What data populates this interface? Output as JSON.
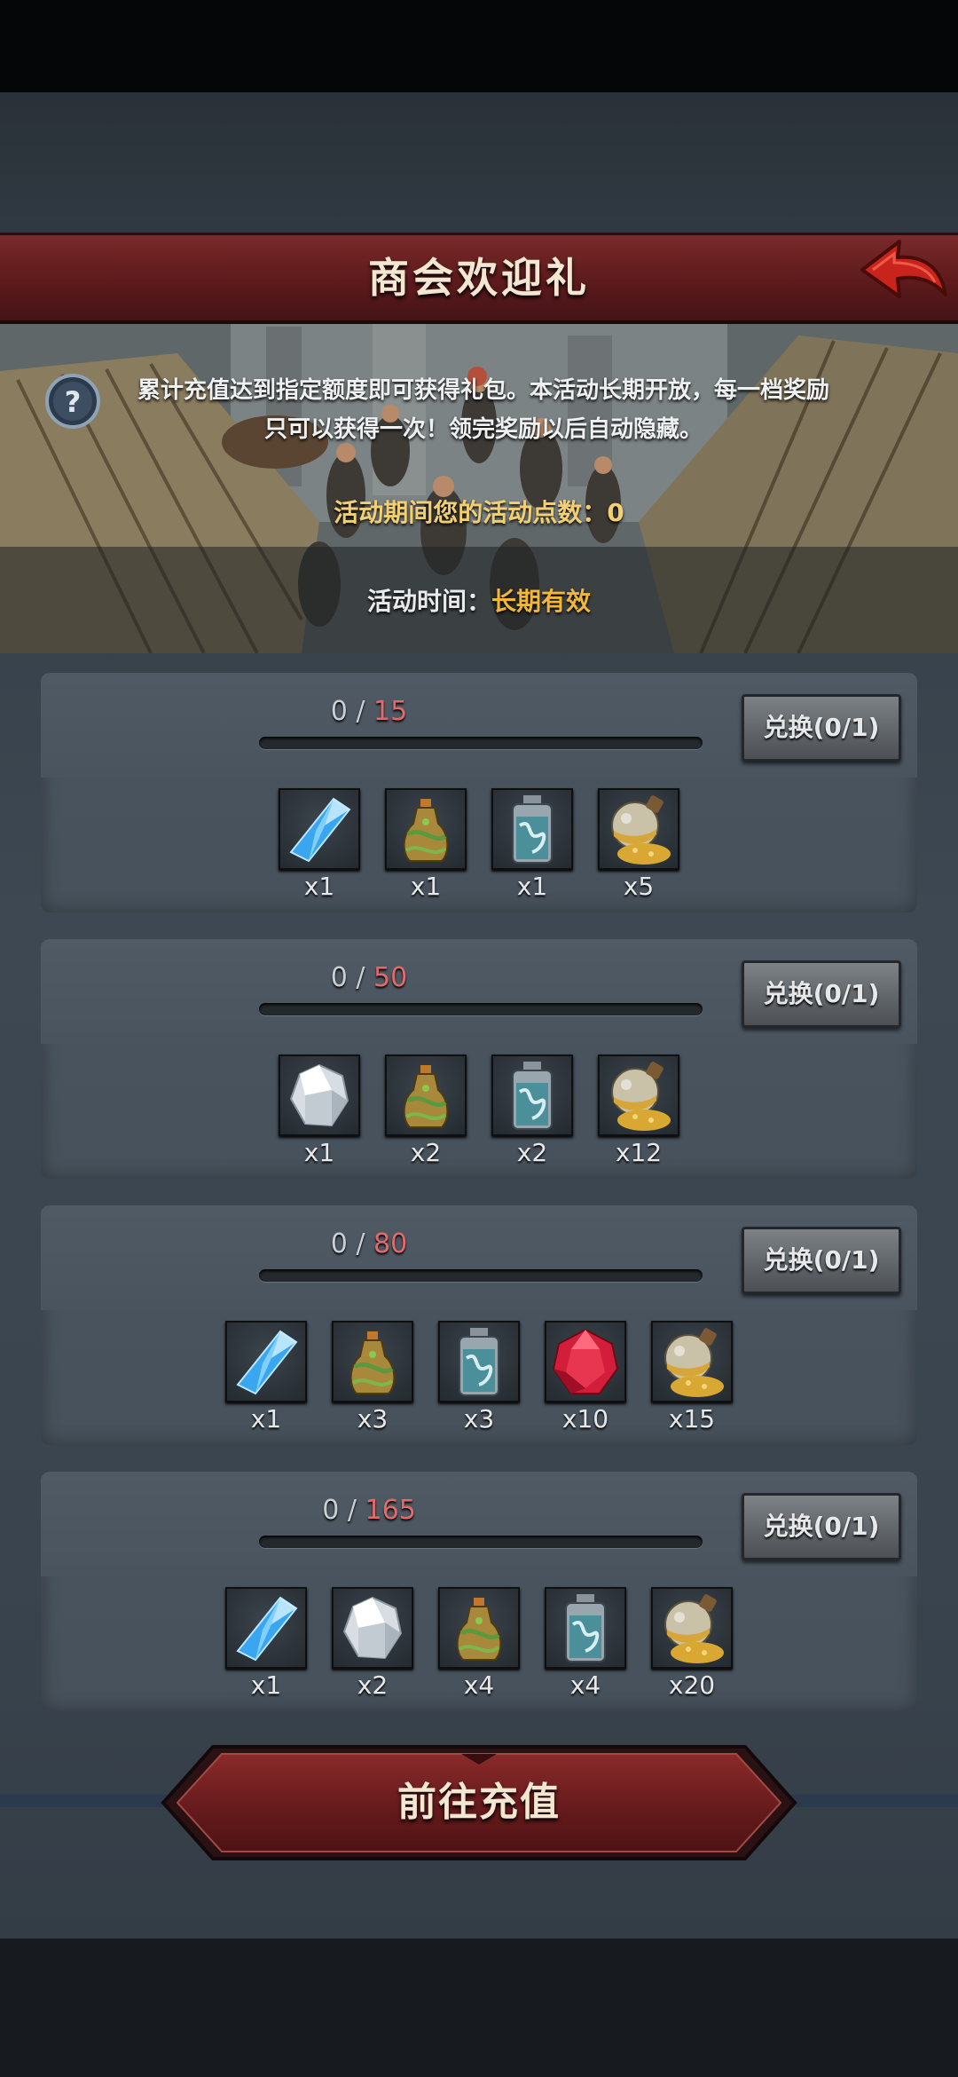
{
  "header": {
    "title": "商会欢迎礼"
  },
  "info": {
    "description_line1": "累计充值达到指定额度即可获得礼包。本活动长期开放，每一档奖励",
    "description_line2": "只可以获得一次！领完奖励以后自动隐藏。",
    "points_label": "活动期间您的活动点数：",
    "points_value": "0",
    "period_label": "活动时间：",
    "period_value": "长期有效"
  },
  "tiers": [
    {
      "current": "0",
      "sep": "/",
      "goal": "15",
      "progress": 0,
      "exchange_label": "兑换(0/1)",
      "items": [
        {
          "icon": "blue-crystal-icon",
          "qty": "x1"
        },
        {
          "icon": "herb-bottle-icon",
          "qty": "x1"
        },
        {
          "icon": "silver-flask-icon",
          "qty": "x1"
        },
        {
          "icon": "gold-powder-flask-icon",
          "qty": "x5"
        }
      ]
    },
    {
      "current": "0",
      "sep": "/",
      "goal": "50",
      "progress": 0,
      "exchange_label": "兑换(0/1)",
      "items": [
        {
          "icon": "white-crystal-icon",
          "qty": "x1"
        },
        {
          "icon": "herb-bottle-icon",
          "qty": "x2"
        },
        {
          "icon": "silver-flask-icon",
          "qty": "x2"
        },
        {
          "icon": "gold-powder-flask-icon",
          "qty": "x12"
        }
      ]
    },
    {
      "current": "0",
      "sep": "/",
      "goal": "80",
      "progress": 0,
      "exchange_label": "兑换(0/1)",
      "items": [
        {
          "icon": "blue-crystal-icon",
          "qty": "x1"
        },
        {
          "icon": "herb-bottle-icon",
          "qty": "x3"
        },
        {
          "icon": "silver-flask-icon",
          "qty": "x3"
        },
        {
          "icon": "red-gem-icon",
          "qty": "x10"
        },
        {
          "icon": "gold-powder-flask-icon",
          "qty": "x15"
        }
      ]
    },
    {
      "current": "0",
      "sep": "/",
      "goal": "165",
      "progress": 0,
      "exchange_label": "兑换(0/1)",
      "items": [
        {
          "icon": "blue-crystal-icon",
          "qty": "x1"
        },
        {
          "icon": "white-crystal-icon",
          "qty": "x2"
        },
        {
          "icon": "herb-bottle-icon",
          "qty": "x4"
        },
        {
          "icon": "silver-flask-icon",
          "qty": "x4"
        },
        {
          "icon": "gold-powder-flask-icon",
          "qty": "x20"
        }
      ]
    }
  ],
  "footer": {
    "recharge_label": "前往充值"
  },
  "colors": {
    "goal_red": "#e26a6a",
    "gold_text": "#f2cf72",
    "banner_red": "#5c1a1c"
  }
}
